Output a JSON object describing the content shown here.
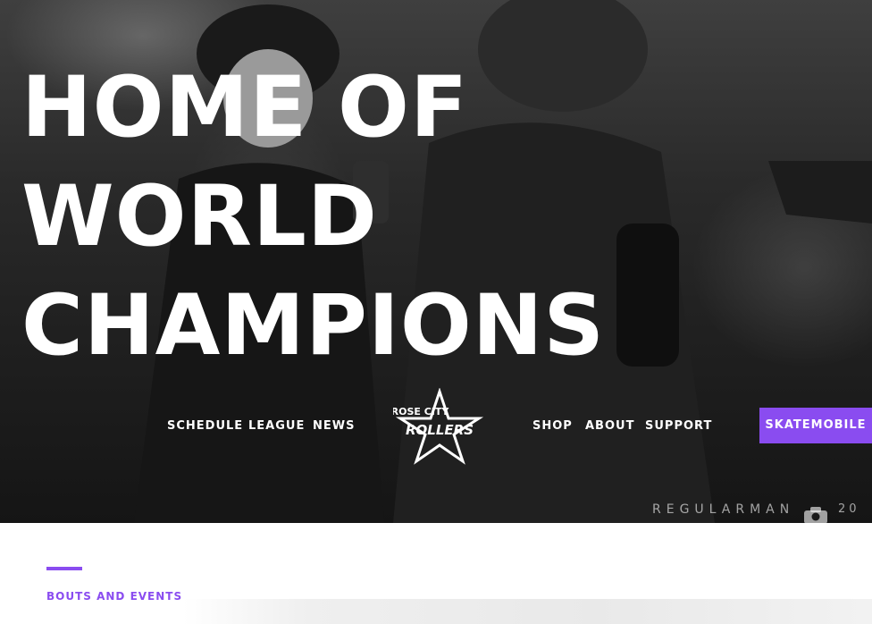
{
  "hero": {
    "title_lines": [
      "HOME OF",
      "WORLD",
      "CHAMPIONS"
    ]
  },
  "nav": {
    "left": [
      "SCHEDULE",
      "LEAGUE",
      "NEWS"
    ],
    "right": [
      "SHOP",
      "ABOUT",
      "SUPPORT"
    ],
    "cta": "SKATEMOBILE"
  },
  "logo": {
    "line1": "ROSE CITY",
    "line2": "ROLLERS"
  },
  "photo_credit": {
    "name": "REGULARMAN",
    "year": "20"
  },
  "section": {
    "label": "BOUTS AND EVENTS"
  },
  "colors": {
    "accent": "#8a4cf0"
  },
  "icons": [
    "star-logo-icon",
    "camera-icon"
  ]
}
